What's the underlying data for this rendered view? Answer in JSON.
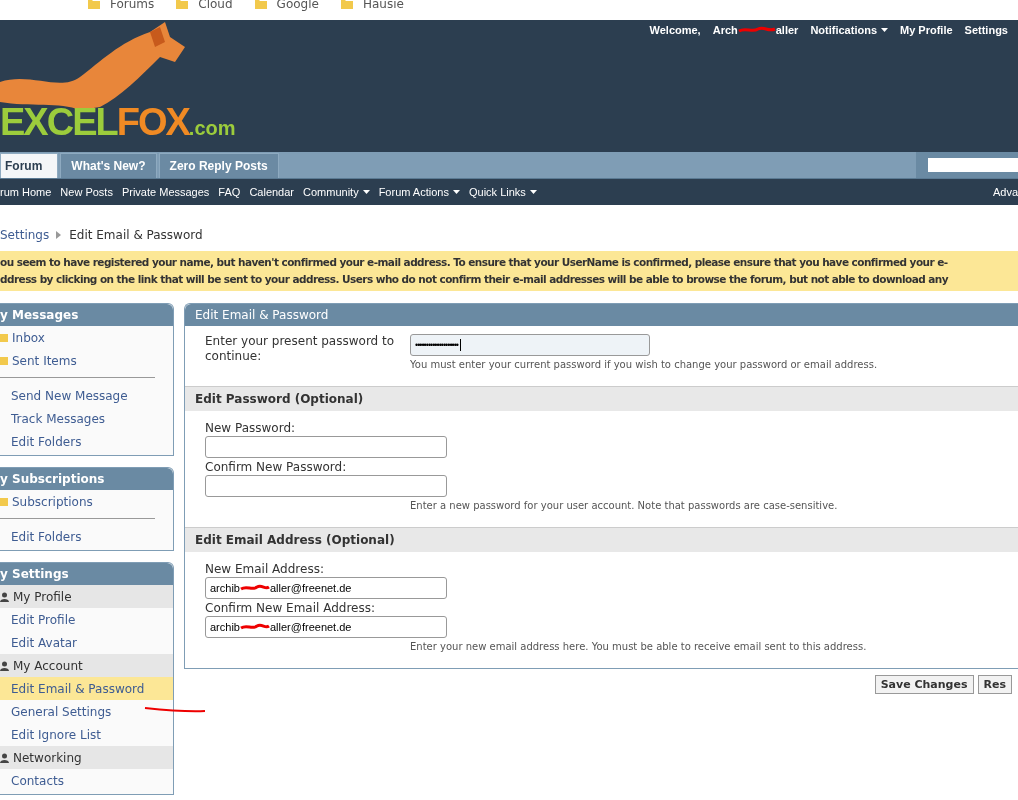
{
  "bookmarks": [
    {
      "label": "Forums"
    },
    {
      "label": "Cloud"
    },
    {
      "label": "Google"
    },
    {
      "label": "Hausie"
    }
  ],
  "header": {
    "welcome": "Welcome,",
    "user_start": "Arch",
    "user_end": "aller",
    "links": [
      {
        "label": "Notifications",
        "dropdown": true
      },
      {
        "label": "My Profile",
        "dropdown": false
      },
      {
        "label": "Settings",
        "dropdown": false
      }
    ]
  },
  "logo": {
    "word": "EXCEL",
    "word2": "FOX",
    "suffix": ".com"
  },
  "tabs": [
    {
      "label": "Forum",
      "selected": true
    },
    {
      "label": "What's New?",
      "selected": false
    },
    {
      "label": "Zero Reply Posts",
      "selected": false
    }
  ],
  "subnav": [
    {
      "label": "rum Home",
      "dropdown": false
    },
    {
      "label": "New Posts",
      "dropdown": false
    },
    {
      "label": "Private Messages",
      "dropdown": false
    },
    {
      "label": "FAQ",
      "dropdown": false
    },
    {
      "label": "Calendar",
      "dropdown": false
    },
    {
      "label": "Community",
      "dropdown": true
    },
    {
      "label": "Forum Actions",
      "dropdown": true
    },
    {
      "label": "Quick Links",
      "dropdown": true
    }
  ],
  "subnav_right": "Adva",
  "breadcrumb": {
    "parent": "Settings",
    "current": "Edit Email & Password"
  },
  "notice": [
    "ou seem to have registered your name, but haven't confirmed your e-mail address. To ensure that your UserName is confirmed, please ensure that you have confirmed your e-",
    "ddress by clicking on the link that will be sent to your address. Users who do not confirm their e-mail addresses will be able to browse the forum, but not able to download any"
  ],
  "sidebar": [
    {
      "title": "y Messages",
      "items": [
        {
          "kind": "folder",
          "label": "Inbox",
          "selected": false
        },
        {
          "kind": "folder",
          "label": "Sent Items",
          "selected": false
        },
        {
          "kind": "divider"
        },
        {
          "kind": "link",
          "label": "Send New Message",
          "selected": false
        },
        {
          "kind": "link",
          "label": "Track Messages",
          "selected": false
        },
        {
          "kind": "link",
          "label": "Edit Folders",
          "selected": false
        }
      ]
    },
    {
      "title": "y Subscriptions",
      "items": [
        {
          "kind": "folder",
          "label": "Subscriptions",
          "selected": false
        },
        {
          "kind": "divider"
        },
        {
          "kind": "link",
          "label": "Edit Folders",
          "selected": false
        }
      ]
    },
    {
      "title": "y Settings",
      "items": [
        {
          "kind": "section",
          "label": "My Profile",
          "selected": false
        },
        {
          "kind": "link",
          "label": "Edit Profile",
          "selected": false
        },
        {
          "kind": "link",
          "label": "Edit Avatar",
          "selected": false
        },
        {
          "kind": "section",
          "label": "My Account",
          "selected": false
        },
        {
          "kind": "link",
          "label": "Edit Email & Password",
          "selected": true
        },
        {
          "kind": "link",
          "label": "General Settings",
          "selected": false
        },
        {
          "kind": "link",
          "label": "Edit Ignore List",
          "selected": false
        },
        {
          "kind": "section",
          "label": "Networking",
          "selected": false
        },
        {
          "kind": "link",
          "label": "Contacts",
          "selected": false
        }
      ]
    }
  ],
  "form": {
    "title": "Edit Email & Password",
    "current": {
      "label": "Enter your present password to continue:",
      "value": "••••••••••••••••••••",
      "hint": "You must enter your current password if you wish to change your password or email address."
    },
    "sections": [
      {
        "title": "Edit Password (Optional)",
        "fields": [
          {
            "label": "New Password:"
          },
          {
            "label": "Confirm New Password:"
          }
        ],
        "hint": "Enter a new password for your user account. Note that passwords are case-sensitive."
      },
      {
        "title": "Edit Email Address (Optional)",
        "fields": [
          {
            "label": "New Email Address:",
            "value_start": "archib",
            "value_end": "aller@freenet.de"
          },
          {
            "label": "Confirm New Email Address:",
            "value_start": "archib",
            "value_end": "aller@freenet.de"
          }
        ],
        "hint": "Enter your new email address here. You must be able to receive email sent to this address."
      }
    ]
  },
  "buttons": [
    {
      "label": "Save Changes"
    },
    {
      "label": "Res"
    }
  ]
}
